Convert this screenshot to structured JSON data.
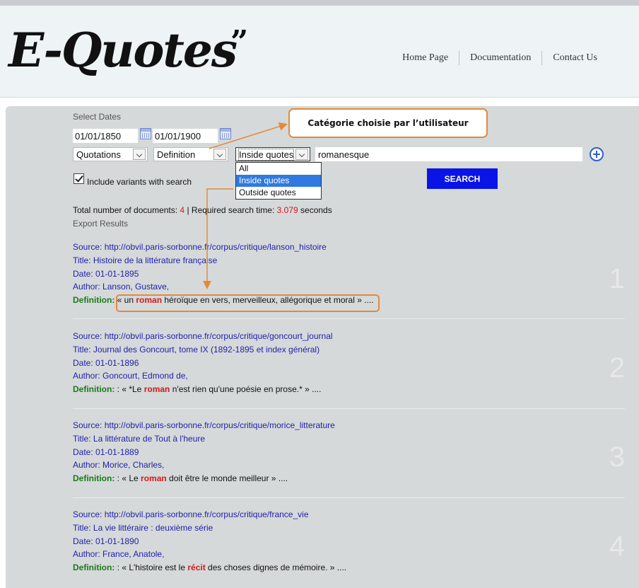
{
  "header": {
    "logo_text": "E-Quotes",
    "logo_quote_mark": "”",
    "nav": [
      "Home Page",
      "Documentation",
      "Contact Us"
    ]
  },
  "form": {
    "select_dates_label": "Select Dates",
    "date_from": "01/01/1850",
    "date_to": "01/01/1900",
    "type_select": "Quotations",
    "field_select": "Definition",
    "scope_select": "Inside quotes",
    "scope_options": [
      "All",
      "Inside quotes",
      "Outside quotes"
    ],
    "search_term": "romanesque",
    "include_variants_label": "Include variants with search",
    "include_variants_checked": true,
    "search_button": "SEARCH"
  },
  "summary": {
    "total_label": "Total number of documents:",
    "total_value": "4",
    "time_label": "| Required search time:",
    "time_value": "3.079",
    "time_unit": "seconds",
    "export_label": "Export Results"
  },
  "results": [
    {
      "source": "Source: http://obvil.paris-sorbonne.fr/corpus/critique/lanson_histoire",
      "title": "Title: Histoire de la littérature française",
      "date": "Date: 01-01-1895",
      "author": "Author: Lanson, Gustave,",
      "def_label": "Definition:",
      "def_pre": " « un ",
      "def_hl": "roman",
      "def_post": " héroïque en vers, merveilleux, allégorique et moral » ....",
      "number": "1"
    },
    {
      "source": "Source: http://obvil.paris-sorbonne.fr/corpus/critique/goncourt_journal",
      "title": "Title: Journal des Goncourt, tome IX (1892-1895 et index général)",
      "date": "Date: 01-01-1896",
      "author": "Author: Goncourt, Edmond de,",
      "def_label": "Definition:",
      "def_pre": " : « *Le ",
      "def_hl": "roman",
      "def_post": " n'est rien qu'une poésie en prose.* » ....",
      "number": "2"
    },
    {
      "source": "Source: http://obvil.paris-sorbonne.fr/corpus/critique/morice_litterature",
      "title": "Title: La littérature de Tout à l'heure",
      "date": "Date: 01-01-1889",
      "author": "Author: Morice, Charles,",
      "def_label": "Definition:",
      "def_pre": " : « Le ",
      "def_hl": "roman",
      "def_post": " doit être le monde meilleur » ....",
      "number": "3"
    },
    {
      "source": "Source: http://obvil.paris-sorbonne.fr/corpus/critique/france_vie",
      "title": "Title: La vie littéraire : deuxième série",
      "date": "Date: 01-01-1890",
      "author": "Author: France, Anatole,",
      "def_label": "Definition:",
      "def_pre": " : « L'histoire est le ",
      "def_hl": "récit",
      "def_post": " des choses dignes de mémoire. » ....",
      "number": "4"
    }
  ],
  "annotation": {
    "callout": "Catégorie choisie par l’utilisateur",
    "accent_color": "#e38a3a"
  }
}
